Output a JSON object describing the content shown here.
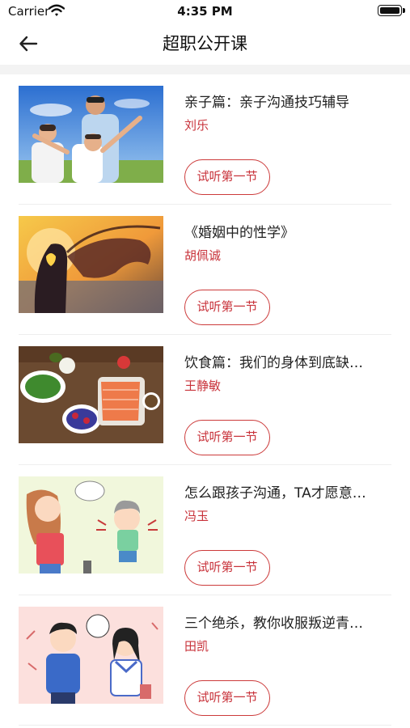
{
  "status_bar": {
    "carrier": "Carrier",
    "time": "4:35 PM"
  },
  "header": {
    "title": "超职公开课"
  },
  "courses": [
    {
      "title": "亲子篇：亲子沟通技巧辅导",
      "author": "刘乐",
      "button": "试听第一节"
    },
    {
      "title": "《婚姻中的性学》",
      "author": "胡佩诚",
      "button": "试听第一节"
    },
    {
      "title": "饮食篇：我们的身体到底缺…",
      "author": "王静敏",
      "button": "试听第一节"
    },
    {
      "title": "怎么跟孩子沟通，TA才愿意…",
      "author": "冯玉",
      "button": "试听第一节"
    },
    {
      "title": "三个绝杀，教你收服叛逆青…",
      "author": "田凯",
      "button": "试听第一节"
    }
  ],
  "colors": {
    "accent": "#c8323a",
    "divider": "#f3f3f3"
  }
}
